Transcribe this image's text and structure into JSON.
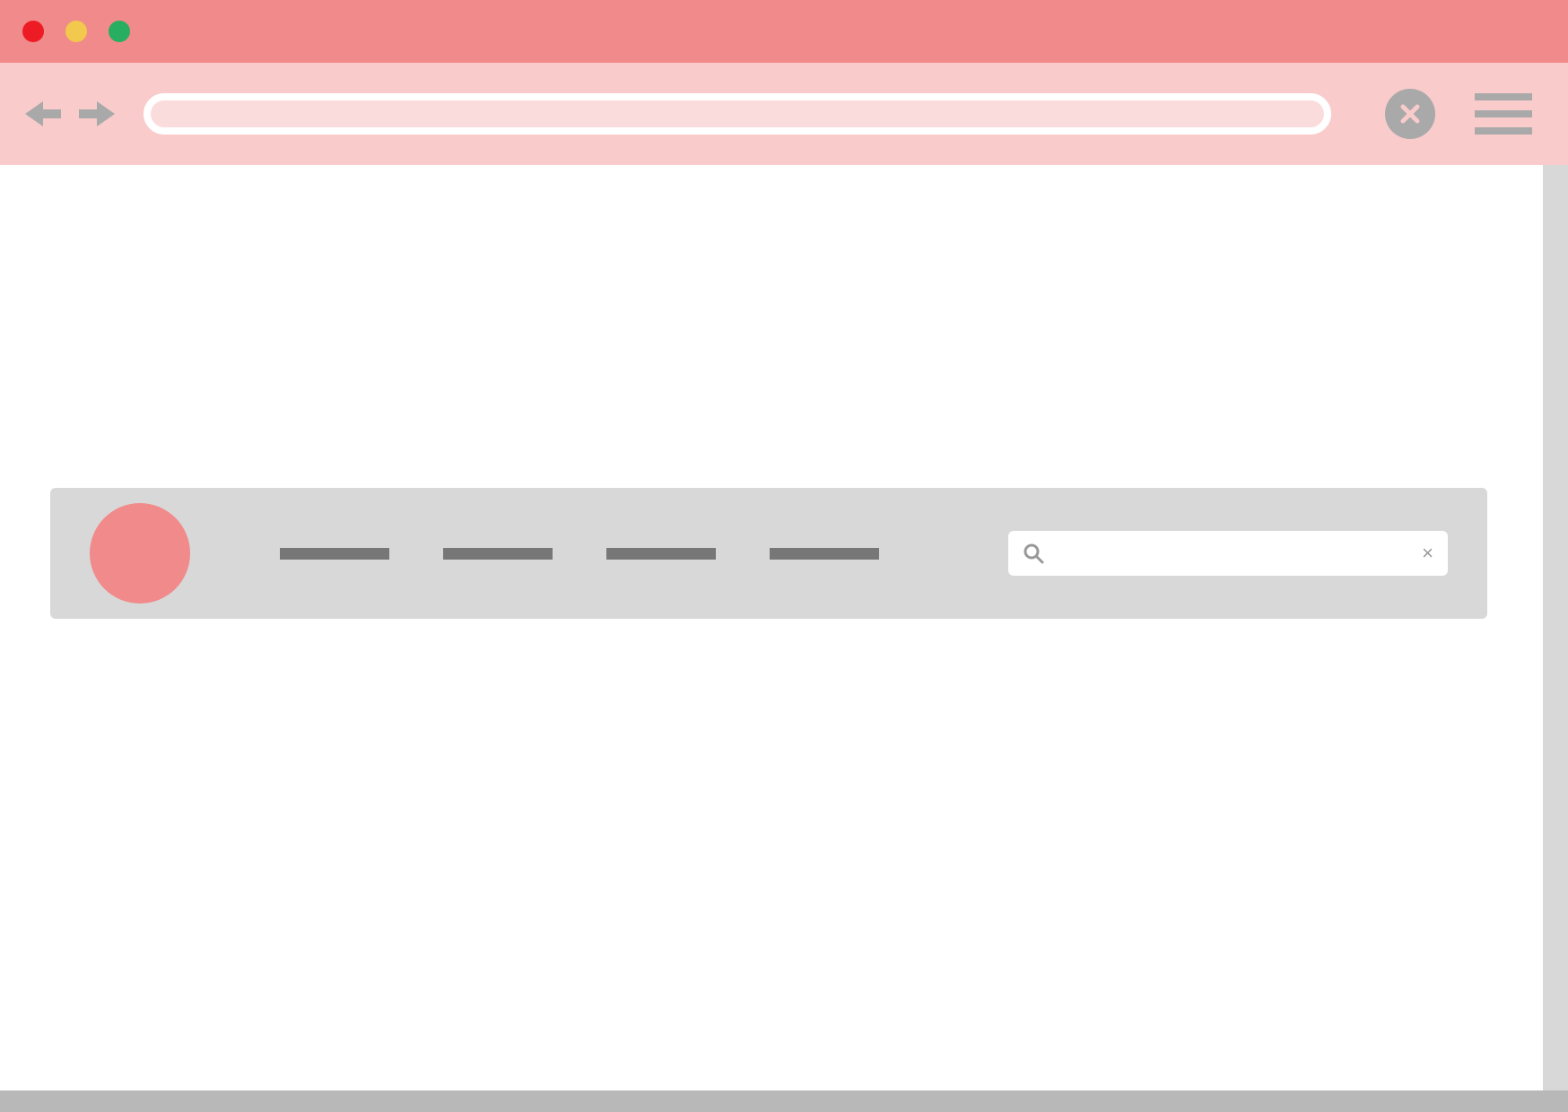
{
  "window": {
    "controls": {
      "close_color": "#ed1c24",
      "minimize_color": "#f2c94c",
      "maximize_color": "#27ae60"
    }
  },
  "toolbar": {
    "address_value": "",
    "address_placeholder": ""
  },
  "page": {
    "navbar": {
      "logo_color": "#f18a8a",
      "links": [
        {
          "label": ""
        },
        {
          "label": ""
        },
        {
          "label": ""
        },
        {
          "label": ""
        }
      ],
      "search": {
        "value": "",
        "placeholder": ""
      }
    }
  }
}
